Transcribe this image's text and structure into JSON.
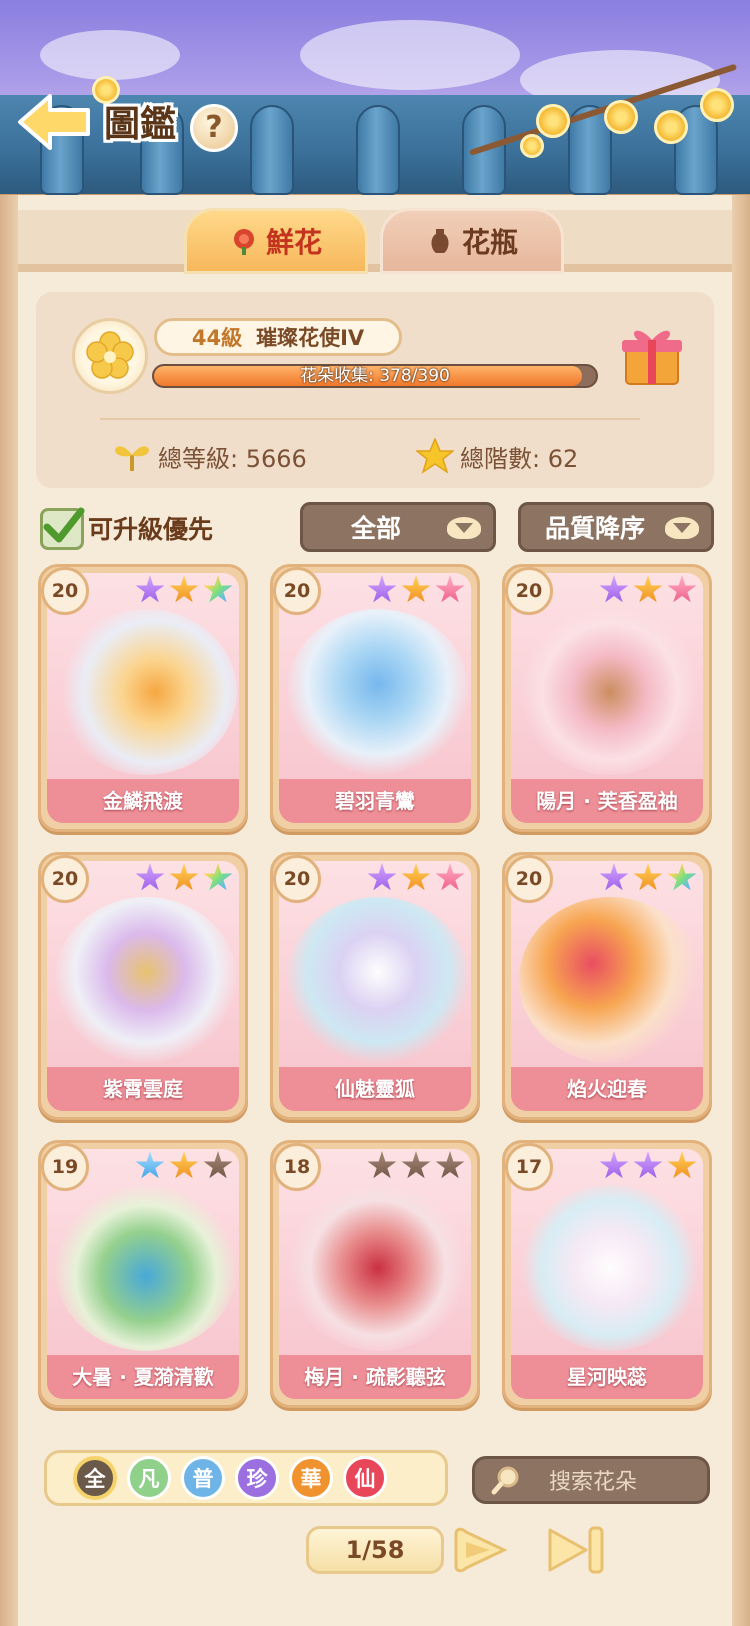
{
  "header": {
    "title": "圖鑑",
    "help_symbol": "?"
  },
  "tabs": [
    {
      "label": "鮮花",
      "active": true
    },
    {
      "label": "花瓶",
      "active": false
    }
  ],
  "summary": {
    "level_label": "44級",
    "rank_title": "璀璨花使IV",
    "collection_text": "花朵收集: 378/390",
    "collection_progress": 0.969,
    "total_level_text": "總等級: 5666",
    "total_stars_text": "總階數: 62"
  },
  "filters": {
    "upgrade_first_label": "可升級優先",
    "upgrade_first_checked": true,
    "category_selected": "全部",
    "sort_selected": "品質降序"
  },
  "cards": [
    {
      "level": "20",
      "name": "金鱗飛渡",
      "stars": [
        "purple",
        "orange",
        "rainbow"
      ],
      "art": "koi"
    },
    {
      "level": "20",
      "name": "碧羽青鸞",
      "stars": [
        "purple",
        "orange",
        "pink"
      ],
      "art": "phoenix"
    },
    {
      "level": "20",
      "name": "陽月 · 芙香盈袖",
      "stars": [
        "purple",
        "orange",
        "pink"
      ],
      "art": "maiden"
    },
    {
      "level": "20",
      "name": "紫霄雲庭",
      "stars": [
        "purple",
        "orange",
        "rainbow"
      ],
      "art": "palace"
    },
    {
      "level": "20",
      "name": "仙魅靈狐",
      "stars": [
        "purple",
        "orange",
        "pink"
      ],
      "art": "fox"
    },
    {
      "level": "20",
      "name": "焰火迎春",
      "stars": [
        "purple",
        "orange",
        "rainbow"
      ],
      "art": "lion"
    },
    {
      "level": "19",
      "name": "大暑 · 夏漪清歡",
      "stars": [
        "blue",
        "orange",
        "brown"
      ],
      "art": "summer"
    },
    {
      "level": "18",
      "name": "梅月 · 疏影聽弦",
      "stars": [
        "brown",
        "brown",
        "brown"
      ],
      "art": "plum"
    },
    {
      "level": "17",
      "name": "星河映蕊",
      "stars": [
        "purple",
        "purple",
        "orange"
      ],
      "art": "peony"
    }
  ],
  "rarity_filters": [
    {
      "label": "全",
      "color": "#6b5a4a",
      "selected": true
    },
    {
      "label": "凡",
      "color": "#8fd08a",
      "selected": false
    },
    {
      "label": "普",
      "color": "#6fb4e6",
      "selected": false
    },
    {
      "label": "珍",
      "color": "#9b6fe0",
      "selected": false
    },
    {
      "label": "華",
      "color": "#f0922e",
      "selected": false
    },
    {
      "label": "仙",
      "color": "#e8475a",
      "selected": false
    }
  ],
  "search": {
    "placeholder": "搜索花朵"
  },
  "pagination": {
    "text": "1/58"
  },
  "colors": {
    "accent_orange": "#f0782a",
    "card_name_bg": "#ee8f98",
    "star_purple": "#b27cf0",
    "star_orange": "#f7a51c",
    "star_pink": "#f47a9a",
    "star_blue": "#5fb8f0",
    "star_brown": "#8a6a5a"
  },
  "icons": {
    "back": "back-arrow-icon",
    "help": "question-icon",
    "flower_tab": "rose-icon",
    "vase_tab": "vase-icon",
    "level_medal": "plum-blossom-icon",
    "gift": "gift-box-icon",
    "total_level": "sprout-icon",
    "total_stars": "star-icon",
    "search": "magnifier-icon",
    "next_page": "next-page-icon",
    "last_page": "last-page-icon"
  }
}
